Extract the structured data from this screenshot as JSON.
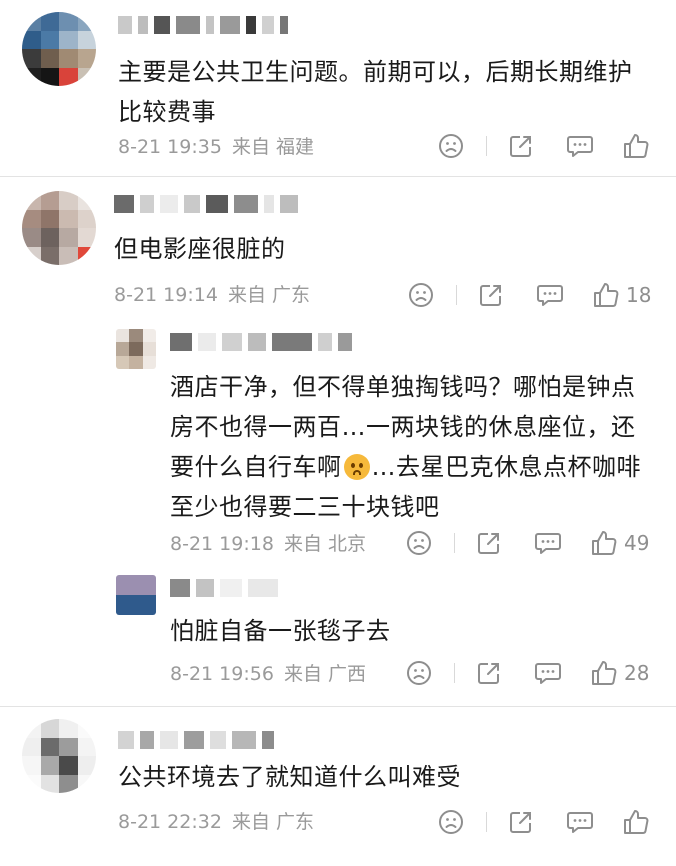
{
  "comments": [
    {
      "text_lines": [
        "主要是公共卫生问题。前期可以，后期长期维护",
        "比较费事"
      ],
      "time": "8-21 19:35",
      "source_prefix": "来自",
      "location": "福建",
      "likes": ""
    },
    {
      "text_lines": [
        "但电影座很脏的"
      ],
      "time": "8-21 19:14",
      "source_prefix": "来自",
      "location": "广东",
      "likes": "18",
      "replies": [
        {
          "text_lines": [
            "酒店干净，但不得单独掏钱吗？哪怕是钟点",
            "房不也得一两百…一两块钱的休息座位，还",
            "要什么自行车啊",
            "…去星巴克休息点杯咖啡",
            "至少也得要二三十块钱吧"
          ],
          "emoji": "frowning-face",
          "time": "8-21 19:18",
          "source_prefix": "来自",
          "location": "北京",
          "likes": "49"
        },
        {
          "text_lines": [
            "怕脏自备一张毯子去"
          ],
          "time": "8-21 19:56",
          "source_prefix": "来自",
          "location": "广西",
          "likes": "28"
        }
      ]
    },
    {
      "text_lines": [
        "公共环境去了就知道什么叫难受"
      ],
      "time": "8-21 22:32",
      "source_prefix": "来自",
      "location": "广东",
      "likes": ""
    }
  ],
  "icons": {
    "dislike": "frown-icon",
    "share": "share-icon",
    "reply": "comment-icon",
    "like": "thumbs-up-icon"
  },
  "colors": {
    "text": "#1a1a1a",
    "meta": "#9a9a9a",
    "icon": "#8e8e8e",
    "divider": "#e3e3e3"
  }
}
